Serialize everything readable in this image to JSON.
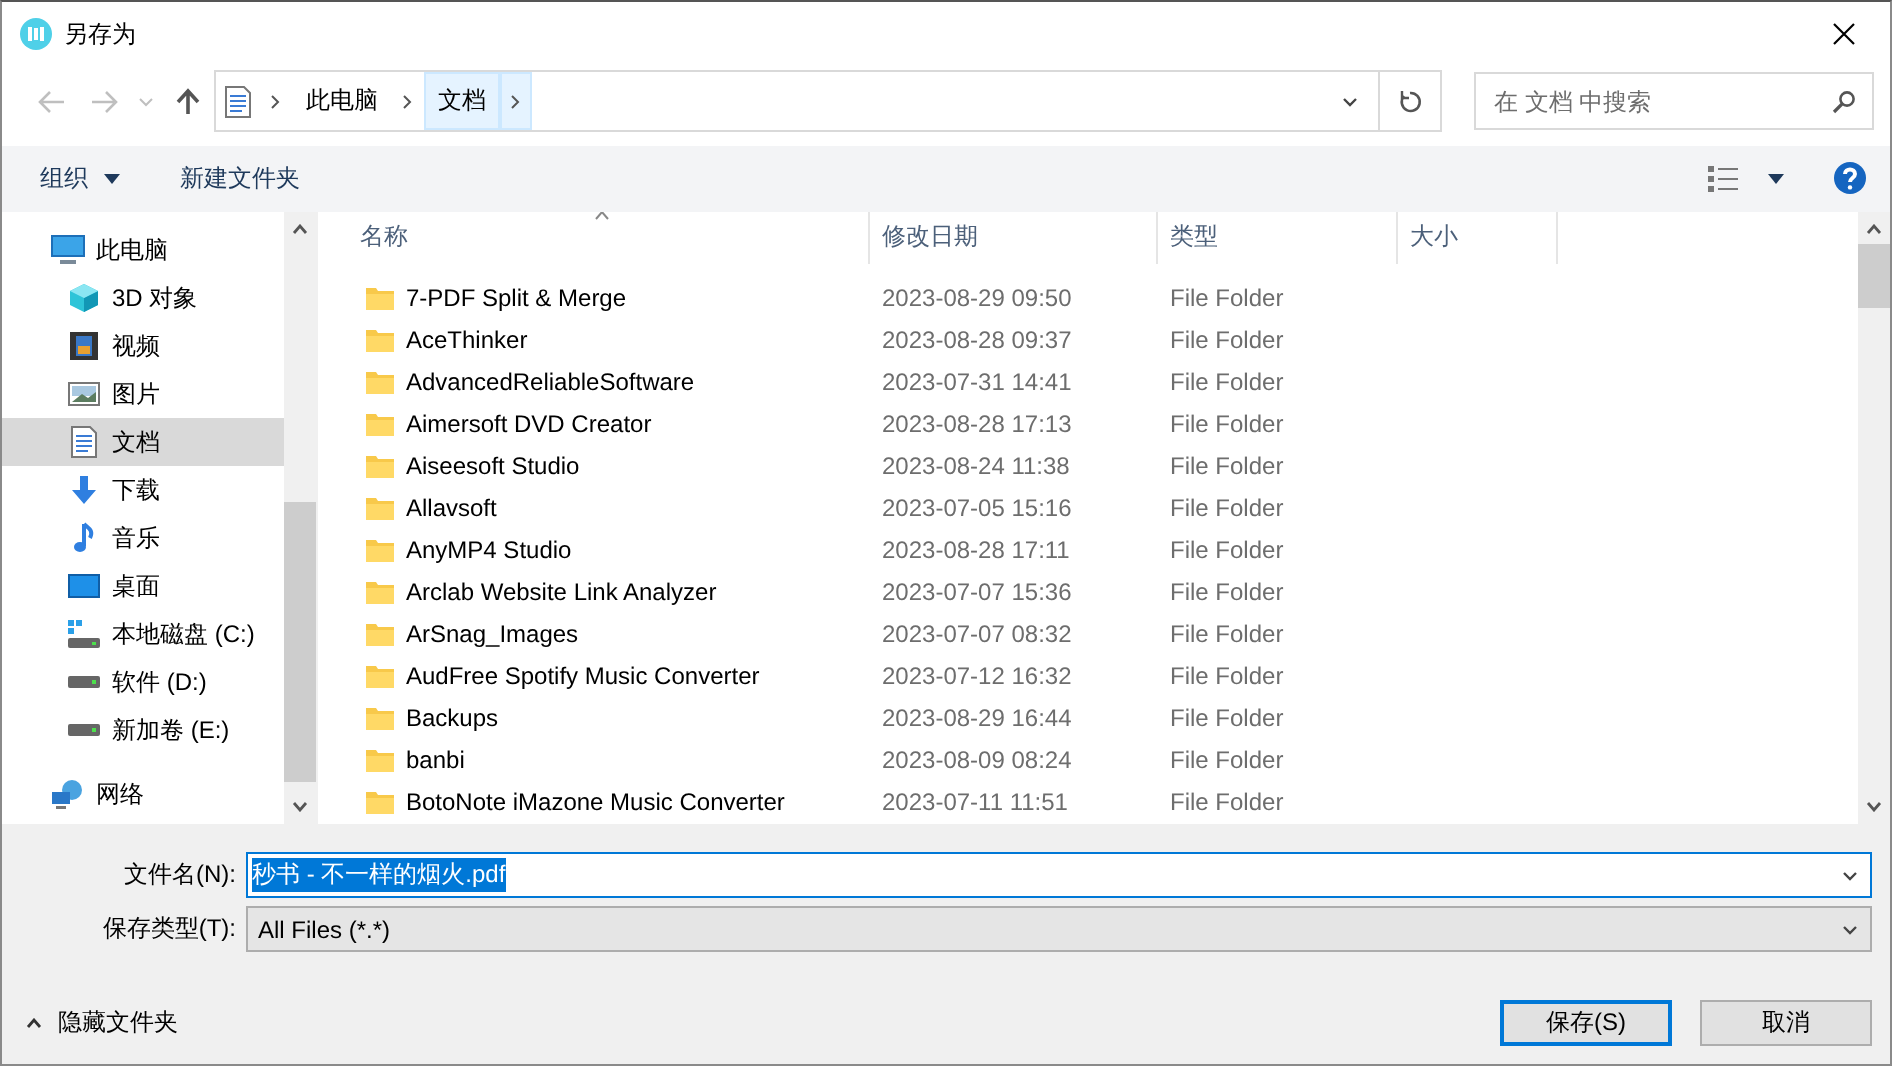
{
  "window": {
    "title": "另存为"
  },
  "address": {
    "crumbs": [
      "此电脑",
      "文档"
    ],
    "search_placeholder": "在 文档 中搜索"
  },
  "toolbar": {
    "organize": "组织",
    "new_folder": "新建文件夹"
  },
  "sidebar": {
    "items": [
      {
        "label": "此电脑",
        "kind": "pc",
        "selected": false,
        "children": [
          {
            "label": "3D 对象",
            "kind": "cube",
            "selected": false
          },
          {
            "label": "视频",
            "kind": "video",
            "selected": false
          },
          {
            "label": "图片",
            "kind": "image",
            "selected": false
          },
          {
            "label": "文档",
            "kind": "doc",
            "selected": true
          },
          {
            "label": "下载",
            "kind": "download",
            "selected": false
          },
          {
            "label": "音乐",
            "kind": "music",
            "selected": false
          },
          {
            "label": "桌面",
            "kind": "desktop",
            "selected": false
          },
          {
            "label": "本地磁盘 (C:)",
            "kind": "sysdrive",
            "selected": false
          },
          {
            "label": "软件 (D:)",
            "kind": "drive",
            "selected": false
          },
          {
            "label": "新加卷 (E:)",
            "kind": "drive",
            "selected": false
          }
        ]
      },
      {
        "label": "网络",
        "kind": "network",
        "selected": false
      }
    ]
  },
  "files": {
    "columns": [
      {
        "label": "名称",
        "sorted": true
      },
      {
        "label": "修改日期",
        "sorted": false
      },
      {
        "label": "类型",
        "sorted": false
      },
      {
        "label": "大小",
        "sorted": false
      }
    ],
    "rows": [
      {
        "name": "7-PDF Split & Merge",
        "date": "2023-08-29 09:50",
        "type": "File Folder"
      },
      {
        "name": "AceThinker",
        "date": "2023-08-28 09:37",
        "type": "File Folder"
      },
      {
        "name": "AdvancedReliableSoftware",
        "date": "2023-07-31 14:41",
        "type": "File Folder"
      },
      {
        "name": "Aimersoft DVD Creator",
        "date": "2023-08-28 17:13",
        "type": "File Folder"
      },
      {
        "name": "Aiseesoft Studio",
        "date": "2023-08-24 11:38",
        "type": "File Folder"
      },
      {
        "name": "Allavsoft",
        "date": "2023-07-05 15:16",
        "type": "File Folder"
      },
      {
        "name": "AnyMP4 Studio",
        "date": "2023-08-28 17:11",
        "type": "File Folder"
      },
      {
        "name": "Arclab Website Link Analyzer",
        "date": "2023-07-07 15:36",
        "type": "File Folder"
      },
      {
        "name": "ArSnag_Images",
        "date": "2023-07-07 08:32",
        "type": "File Folder"
      },
      {
        "name": "AudFree Spotify Music Converter",
        "date": "2023-07-12 16:32",
        "type": "File Folder"
      },
      {
        "name": "Backups",
        "date": "2023-08-29 16:44",
        "type": "File Folder"
      },
      {
        "name": "banbi",
        "date": "2023-08-09 08:24",
        "type": "File Folder"
      },
      {
        "name": "BotoNote iMazone Music Converter",
        "date": "2023-07-11 11:51",
        "type": "File Folder"
      }
    ]
  },
  "form": {
    "filename_label": "文件名(N):",
    "filename": {
      "value": "秒书 - 不一样的烟火.pdf",
      "selected": true
    },
    "type_label": "保存类型(T):",
    "type_value": "All Files (*.*)"
  },
  "footer": {
    "hide_folders": "隐藏文件夹",
    "buttons": [
      {
        "label": "保存(S)",
        "default": true
      },
      {
        "label": "取消",
        "default": false
      }
    ]
  }
}
